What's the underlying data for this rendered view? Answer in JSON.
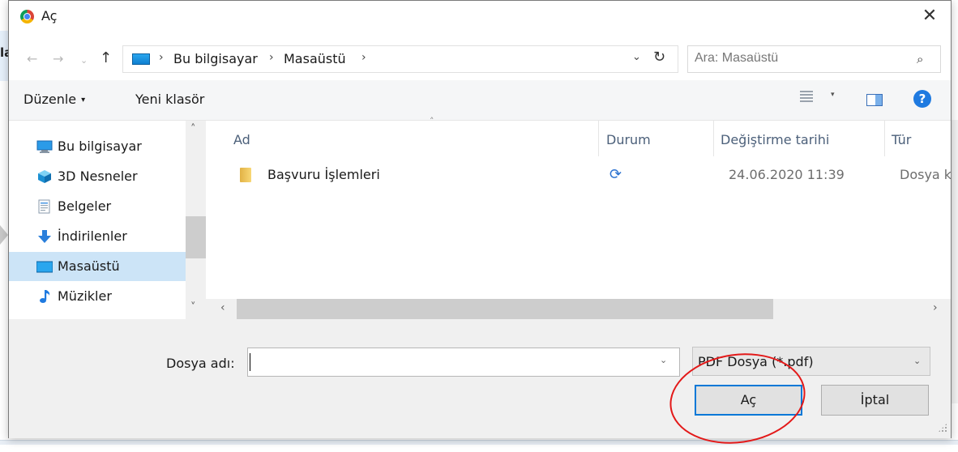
{
  "background": {
    "side_text": "la"
  },
  "window": {
    "title": "Aç",
    "close_glyph": "✕",
    "app_icon": "chrome-icon"
  },
  "nav": {
    "back_glyph": "←",
    "forward_glyph": "→",
    "recent_glyph": "⌄",
    "up_glyph": "↑",
    "breadcrumb": [
      "Bu bilgisayar",
      "Masaüstü"
    ],
    "separator": "›",
    "dropdown_glyph": "⌄",
    "refresh_glyph": "↻",
    "search_placeholder": "Ara: Masaüstü",
    "search_glyph": "⌕"
  },
  "toolbar": {
    "organize_label": "Düzenle",
    "organize_caret": "▾",
    "new_folder_label": "Yeni klasör",
    "view_caret": "▾",
    "help_label": "?"
  },
  "tree": {
    "items": [
      {
        "label": "Bu bilgisayar",
        "icon": "computer-icon"
      },
      {
        "label": "3D Nesneler",
        "icon": "cube-icon"
      },
      {
        "label": "Belgeler",
        "icon": "document-icon"
      },
      {
        "label": "İndirilenler",
        "icon": "download-icon"
      },
      {
        "label": "Masaüstü",
        "icon": "desktop-icon",
        "selected": true
      },
      {
        "label": "Müzikler",
        "icon": "music-icon"
      }
    ],
    "scroll_up": "˄",
    "scroll_down": "˅"
  },
  "files": {
    "sort_indicator": "˄",
    "columns": [
      "Ad",
      "Durum",
      "Değiştirme tarihi",
      "Tür"
    ],
    "rows": [
      {
        "name": "Başvuru İşlemleri",
        "status_icon": "sync-icon",
        "status_glyph": "⟳",
        "modified": "24.06.2020 11:39",
        "type": "Dosya kla"
      }
    ],
    "hscroll_left": "‹",
    "hscroll_right": "›"
  },
  "footer": {
    "filename_label": "Dosya adı:",
    "filename_value": "",
    "filename_caret": "⌄",
    "filetype_value": "PDF Dosya (*.pdf)",
    "filetype_caret": "⌄",
    "open_label": "Aç",
    "cancel_label": "İptal"
  },
  "colors": {
    "selection": "#cce4f7",
    "accent": "#0078d7",
    "highlight_oval": "#e31919",
    "help": "#1f7ae0"
  }
}
